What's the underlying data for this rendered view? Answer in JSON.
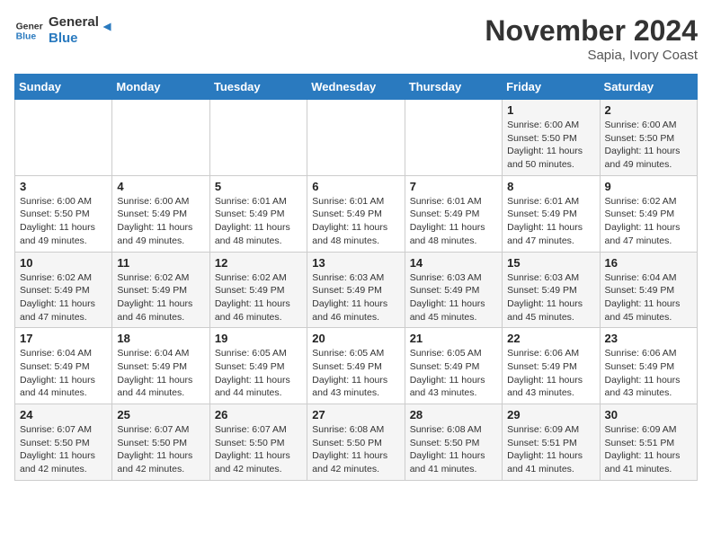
{
  "header": {
    "logo_line1": "General",
    "logo_line2": "Blue",
    "month": "November 2024",
    "location": "Sapia, Ivory Coast"
  },
  "weekdays": [
    "Sunday",
    "Monday",
    "Tuesday",
    "Wednesday",
    "Thursday",
    "Friday",
    "Saturday"
  ],
  "weeks": [
    [
      {
        "day": "",
        "info": ""
      },
      {
        "day": "",
        "info": ""
      },
      {
        "day": "",
        "info": ""
      },
      {
        "day": "",
        "info": ""
      },
      {
        "day": "",
        "info": ""
      },
      {
        "day": "1",
        "info": "Sunrise: 6:00 AM\nSunset: 5:50 PM\nDaylight: 11 hours\nand 50 minutes."
      },
      {
        "day": "2",
        "info": "Sunrise: 6:00 AM\nSunset: 5:50 PM\nDaylight: 11 hours\nand 49 minutes."
      }
    ],
    [
      {
        "day": "3",
        "info": "Sunrise: 6:00 AM\nSunset: 5:50 PM\nDaylight: 11 hours\nand 49 minutes."
      },
      {
        "day": "4",
        "info": "Sunrise: 6:00 AM\nSunset: 5:49 PM\nDaylight: 11 hours\nand 49 minutes."
      },
      {
        "day": "5",
        "info": "Sunrise: 6:01 AM\nSunset: 5:49 PM\nDaylight: 11 hours\nand 48 minutes."
      },
      {
        "day": "6",
        "info": "Sunrise: 6:01 AM\nSunset: 5:49 PM\nDaylight: 11 hours\nand 48 minutes."
      },
      {
        "day": "7",
        "info": "Sunrise: 6:01 AM\nSunset: 5:49 PM\nDaylight: 11 hours\nand 48 minutes."
      },
      {
        "day": "8",
        "info": "Sunrise: 6:01 AM\nSunset: 5:49 PM\nDaylight: 11 hours\nand 47 minutes."
      },
      {
        "day": "9",
        "info": "Sunrise: 6:02 AM\nSunset: 5:49 PM\nDaylight: 11 hours\nand 47 minutes."
      }
    ],
    [
      {
        "day": "10",
        "info": "Sunrise: 6:02 AM\nSunset: 5:49 PM\nDaylight: 11 hours\nand 47 minutes."
      },
      {
        "day": "11",
        "info": "Sunrise: 6:02 AM\nSunset: 5:49 PM\nDaylight: 11 hours\nand 46 minutes."
      },
      {
        "day": "12",
        "info": "Sunrise: 6:02 AM\nSunset: 5:49 PM\nDaylight: 11 hours\nand 46 minutes."
      },
      {
        "day": "13",
        "info": "Sunrise: 6:03 AM\nSunset: 5:49 PM\nDaylight: 11 hours\nand 46 minutes."
      },
      {
        "day": "14",
        "info": "Sunrise: 6:03 AM\nSunset: 5:49 PM\nDaylight: 11 hours\nand 45 minutes."
      },
      {
        "day": "15",
        "info": "Sunrise: 6:03 AM\nSunset: 5:49 PM\nDaylight: 11 hours\nand 45 minutes."
      },
      {
        "day": "16",
        "info": "Sunrise: 6:04 AM\nSunset: 5:49 PM\nDaylight: 11 hours\nand 45 minutes."
      }
    ],
    [
      {
        "day": "17",
        "info": "Sunrise: 6:04 AM\nSunset: 5:49 PM\nDaylight: 11 hours\nand 44 minutes."
      },
      {
        "day": "18",
        "info": "Sunrise: 6:04 AM\nSunset: 5:49 PM\nDaylight: 11 hours\nand 44 minutes."
      },
      {
        "day": "19",
        "info": "Sunrise: 6:05 AM\nSunset: 5:49 PM\nDaylight: 11 hours\nand 44 minutes."
      },
      {
        "day": "20",
        "info": "Sunrise: 6:05 AM\nSunset: 5:49 PM\nDaylight: 11 hours\nand 43 minutes."
      },
      {
        "day": "21",
        "info": "Sunrise: 6:05 AM\nSunset: 5:49 PM\nDaylight: 11 hours\nand 43 minutes."
      },
      {
        "day": "22",
        "info": "Sunrise: 6:06 AM\nSunset: 5:49 PM\nDaylight: 11 hours\nand 43 minutes."
      },
      {
        "day": "23",
        "info": "Sunrise: 6:06 AM\nSunset: 5:49 PM\nDaylight: 11 hours\nand 43 minutes."
      }
    ],
    [
      {
        "day": "24",
        "info": "Sunrise: 6:07 AM\nSunset: 5:50 PM\nDaylight: 11 hours\nand 42 minutes."
      },
      {
        "day": "25",
        "info": "Sunrise: 6:07 AM\nSunset: 5:50 PM\nDaylight: 11 hours\nand 42 minutes."
      },
      {
        "day": "26",
        "info": "Sunrise: 6:07 AM\nSunset: 5:50 PM\nDaylight: 11 hours\nand 42 minutes."
      },
      {
        "day": "27",
        "info": "Sunrise: 6:08 AM\nSunset: 5:50 PM\nDaylight: 11 hours\nand 42 minutes."
      },
      {
        "day": "28",
        "info": "Sunrise: 6:08 AM\nSunset: 5:50 PM\nDaylight: 11 hours\nand 41 minutes."
      },
      {
        "day": "29",
        "info": "Sunrise: 6:09 AM\nSunset: 5:51 PM\nDaylight: 11 hours\nand 41 minutes."
      },
      {
        "day": "30",
        "info": "Sunrise: 6:09 AM\nSunset: 5:51 PM\nDaylight: 11 hours\nand 41 minutes."
      }
    ]
  ]
}
